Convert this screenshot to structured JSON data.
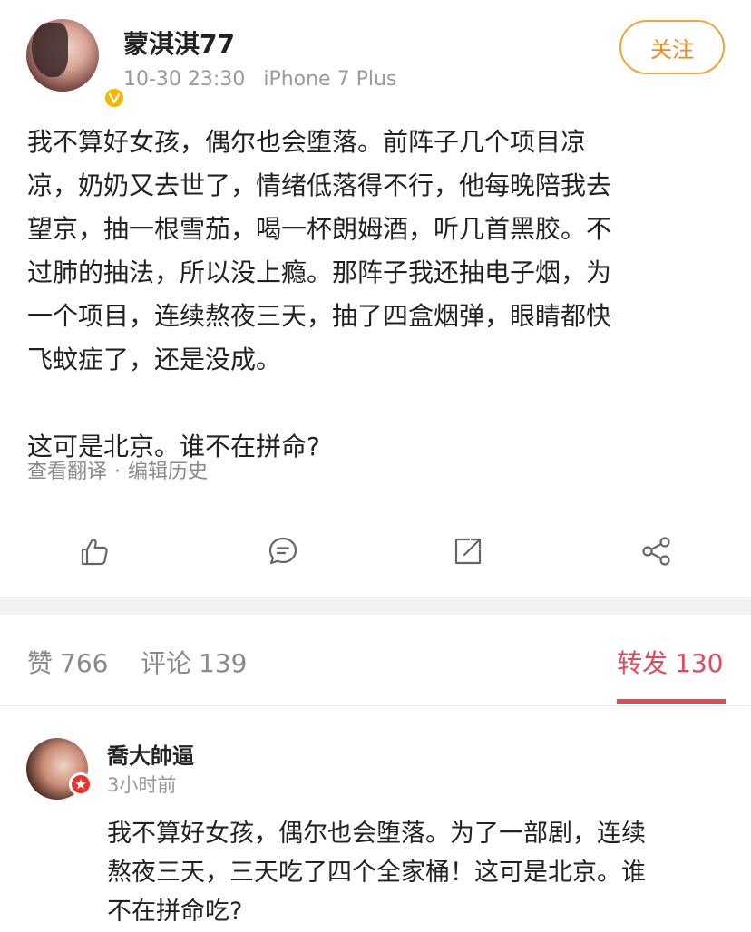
{
  "post": {
    "username": "蒙淇淇77",
    "time": "10-30 23:30",
    "device": "iPhone 7 Plus",
    "follow_label": "关注",
    "body_lines": [
      "我不算好女孩，偶尔也会堕落。前阵子几个项目凉",
      "凉，奶奶又去世了，情绪低落得不行，他每晚陪我去",
      "望京，抽一根雪茄，喝一杯朗姆酒，听几首黑胶。不",
      "过肺的抽法，所以没上瘾。那阵子我还抽电子烟，为",
      "一个项目，连续熬夜三天，抽了四盒烟弹，眼睛都快",
      "飞蚊症了，还是没成。"
    ],
    "body_last": "这可是北京。谁不在拼命?",
    "translate_label": "查看翻译",
    "separator": "·",
    "edit_history_label": "编辑历史"
  },
  "actions": {
    "like_icon": "thumbs-up-icon",
    "comment_icon": "comment-icon",
    "repost_icon": "repost-icon",
    "share_icon": "share-icon"
  },
  "stats": {
    "likes_label": "赞",
    "likes_count": "766",
    "comments_label": "评论",
    "comments_count": "139",
    "reposts_label": "转发",
    "reposts_count": "130"
  },
  "comment": {
    "username": "喬大帥逼",
    "time": "3小时前",
    "text_lines": [
      "我不算好女孩，偶尔也会堕落。为了一部剧，连续",
      "熬夜三天，三天吃了四个全家桶！这可是北京。谁",
      "不在拼命吃?"
    ]
  },
  "colors": {
    "accent_orange": "#f0a43a",
    "active_red": "#e04a5a",
    "muted_gray": "#9a9a9a",
    "vip_badge": "#f7b500",
    "red_badge": "#e8342f"
  }
}
